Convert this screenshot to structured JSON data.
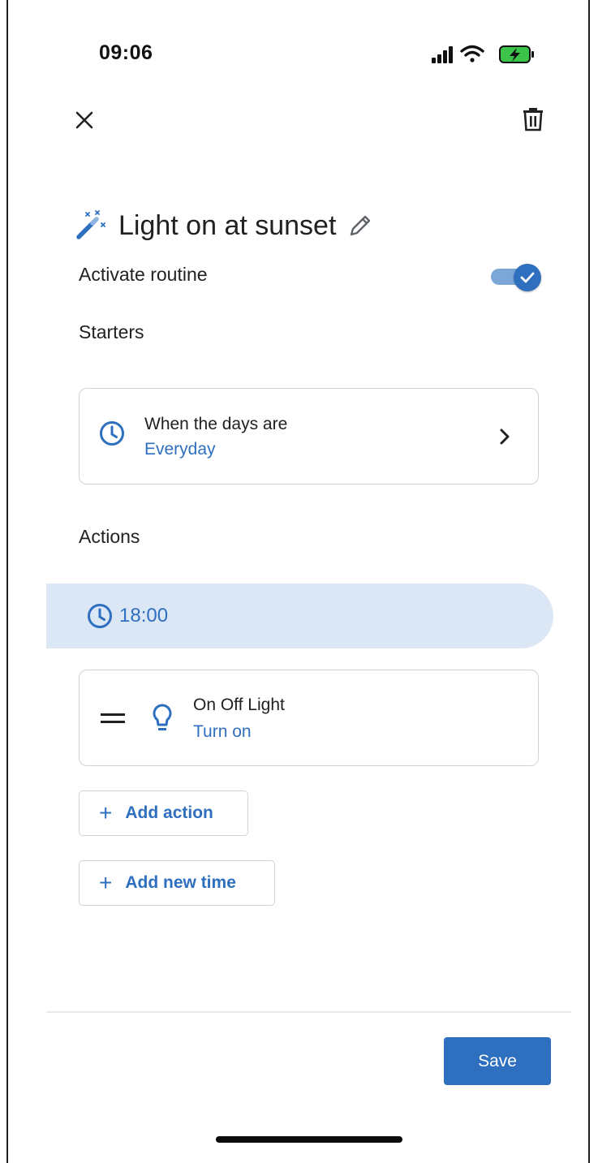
{
  "status_bar": {
    "time": "09:06"
  },
  "header": {
    "close_icon": "close-icon",
    "delete_icon": "trash-icon"
  },
  "routine": {
    "title": "Light on at sunset",
    "activate_label": "Activate routine",
    "activated": true
  },
  "starters": {
    "section_label": "Starters",
    "items": [
      {
        "title": "When the days are",
        "value": "Everyday"
      }
    ]
  },
  "actions": {
    "section_label": "Actions",
    "time": "18:00",
    "items": [
      {
        "title": "On Off Light",
        "value": "Turn on"
      }
    ],
    "add_action_label": "Add action",
    "add_time_label": "Add new time"
  },
  "footer": {
    "save_label": "Save"
  },
  "colors": {
    "accent": "#2f6fbf",
    "banner": "#dce7f5",
    "toggle_track": "#7ba6d8",
    "border": "#cfd3d7"
  }
}
